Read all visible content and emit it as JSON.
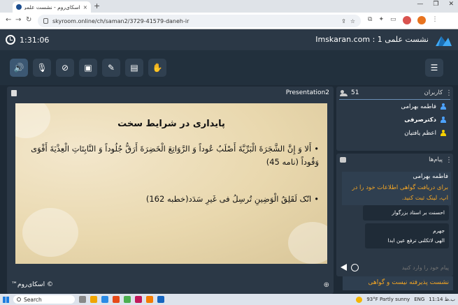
{
  "browser": {
    "tab_title": "اسکای‌روم - نشست علمی 1",
    "tab_close": "×",
    "new_tab": "+",
    "url": "skyroom.online/ch/saman2/3729-41579-daneh-ir",
    "window_controls": [
      "—",
      "❐",
      "✕"
    ]
  },
  "header": {
    "timer": "1:31:06",
    "title": "Imskaran.com : نشست علمی 1"
  },
  "toolbar": {
    "buttons": [
      "speaker-icon",
      "mic-off-icon",
      "camera-off-icon",
      "screen-share-icon",
      "brush-icon",
      "file-icon",
      "hand-icon"
    ],
    "active": "speaker-icon"
  },
  "presentation": {
    "title": "Presentation2",
    "slide_heading": "پایداری در شرایط سخت",
    "bullets": [
      "أَلا وَ إِنَّ الشَّجَرَةَ الْبَرِّيَّةَ أَصْلَبُ عُوداً وَ الرَّوَاتِعَ الْخَضِرَةَ أَرَقُّ جُلُوداً وَ النَّابِتَاتِ الْعِذْيَةَ أَقْوَى وَقُوداً (نامه 45)",
      "انّک لَقَلِقُ الْوَضِینِ تُرسِلُ فی غَیرِ سَدَد(خطبه 162)"
    ],
    "brand": "™اسکای‌روم ©"
  },
  "users": {
    "title": "کاربران",
    "count": "51",
    "list": [
      {
        "name": "فاطمه بهرامی",
        "color": "#4da3ff",
        "bold": false
      },
      {
        "name": "دکترصرفی",
        "color": "#4da3ff",
        "bold": true
      },
      {
        "name": "اعظم یافتیان",
        "color": "#f5d000",
        "bold": false
      }
    ]
  },
  "messages": {
    "title": "پیام‌ها",
    "first": {
      "sender": "فاطمه بهرامی",
      "text": "برای دریافت گواهی اطلاعات خود را در اپ، لینک ثبت کنید."
    },
    "bubble1": "احسنت بر استاد بزرگوار",
    "bubble2_sender": "جهرم",
    "bubble2_text": "الهی لاتکلنی ترفع عین ابدا",
    "input_placeholder": "پیام خود را وارد کنید",
    "toast": "نشست پذیرفته نیست و گواهی"
  },
  "taskbar": {
    "search": "Search",
    "weather": "93°F  Partly sunny",
    "lang": "ENG",
    "time": "11:14 ب.ظ"
  }
}
